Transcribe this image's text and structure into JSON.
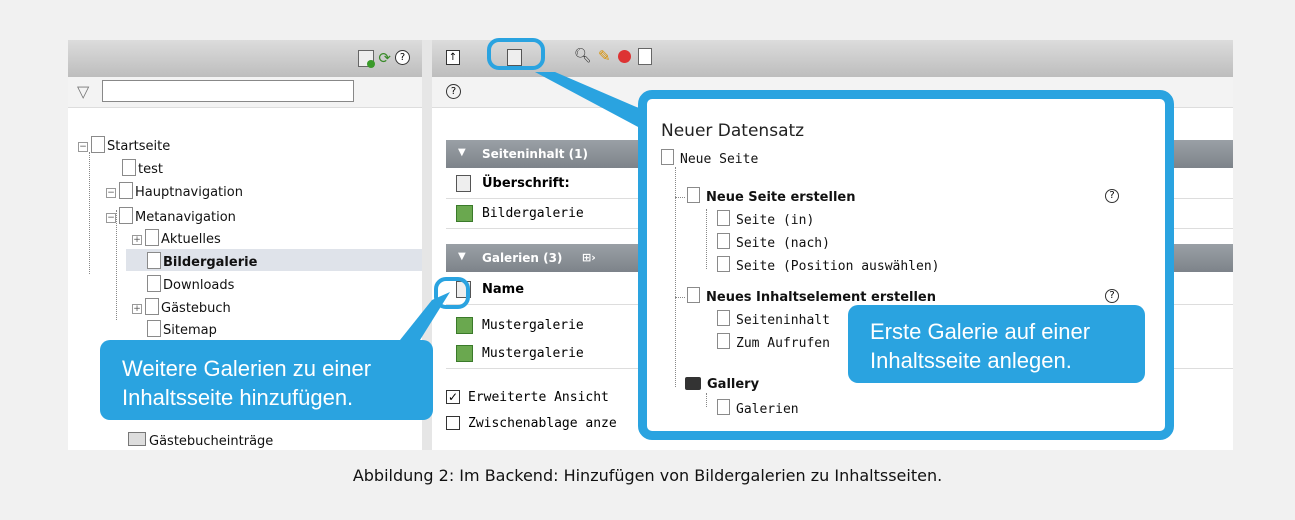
{
  "left_tree": {
    "items": [
      "Startseite",
      "test",
      "Hauptnavigation",
      "Metanavigation",
      "Aktuelles",
      "Bildergalerie",
      "Downloads",
      "Gästebuch",
      "Sitemap",
      "Gästebucheinträge"
    ]
  },
  "right": {
    "section1": {
      "header": "Seiteninhalt (1)",
      "row1": "Überschrift:",
      "row2": "Bildergalerie"
    },
    "section2": {
      "header": "Galerien (3)",
      "name_label": "Name",
      "gallery1": "Mustergalerie",
      "gallery2": "Mustergalerie"
    },
    "checkbox1": "Erweiterte Ansicht",
    "checkbox2": "Zwischenablage anze"
  },
  "popup": {
    "title": "Neuer Datensatz",
    "neue_seite": "Neue Seite",
    "group1": {
      "label": "Neue Seite erstellen",
      "items": [
        "Seite (in)",
        "Seite (nach)",
        "Seite (Position auswählen)"
      ]
    },
    "group2": {
      "label": "Neues Inhaltselement erstellen",
      "items": [
        "Seiteninhalt",
        "Zum Aufrufen"
      ]
    },
    "group3": {
      "label": "Gallery",
      "items": [
        "Galerien"
      ]
    }
  },
  "callouts": {
    "left": "Weitere Galerien zu einer Inhaltsseite hinzufügen.",
    "right": "Erste Galerie auf einer Inhaltsseite anlegen."
  },
  "caption": "Abbildung 2: Im Backend: Hinzufügen von Bildergalerien zu Inhaltsseiten.",
  "colors": {
    "accent": "#2aa3e0",
    "header_bg": "#c8c8c8"
  }
}
